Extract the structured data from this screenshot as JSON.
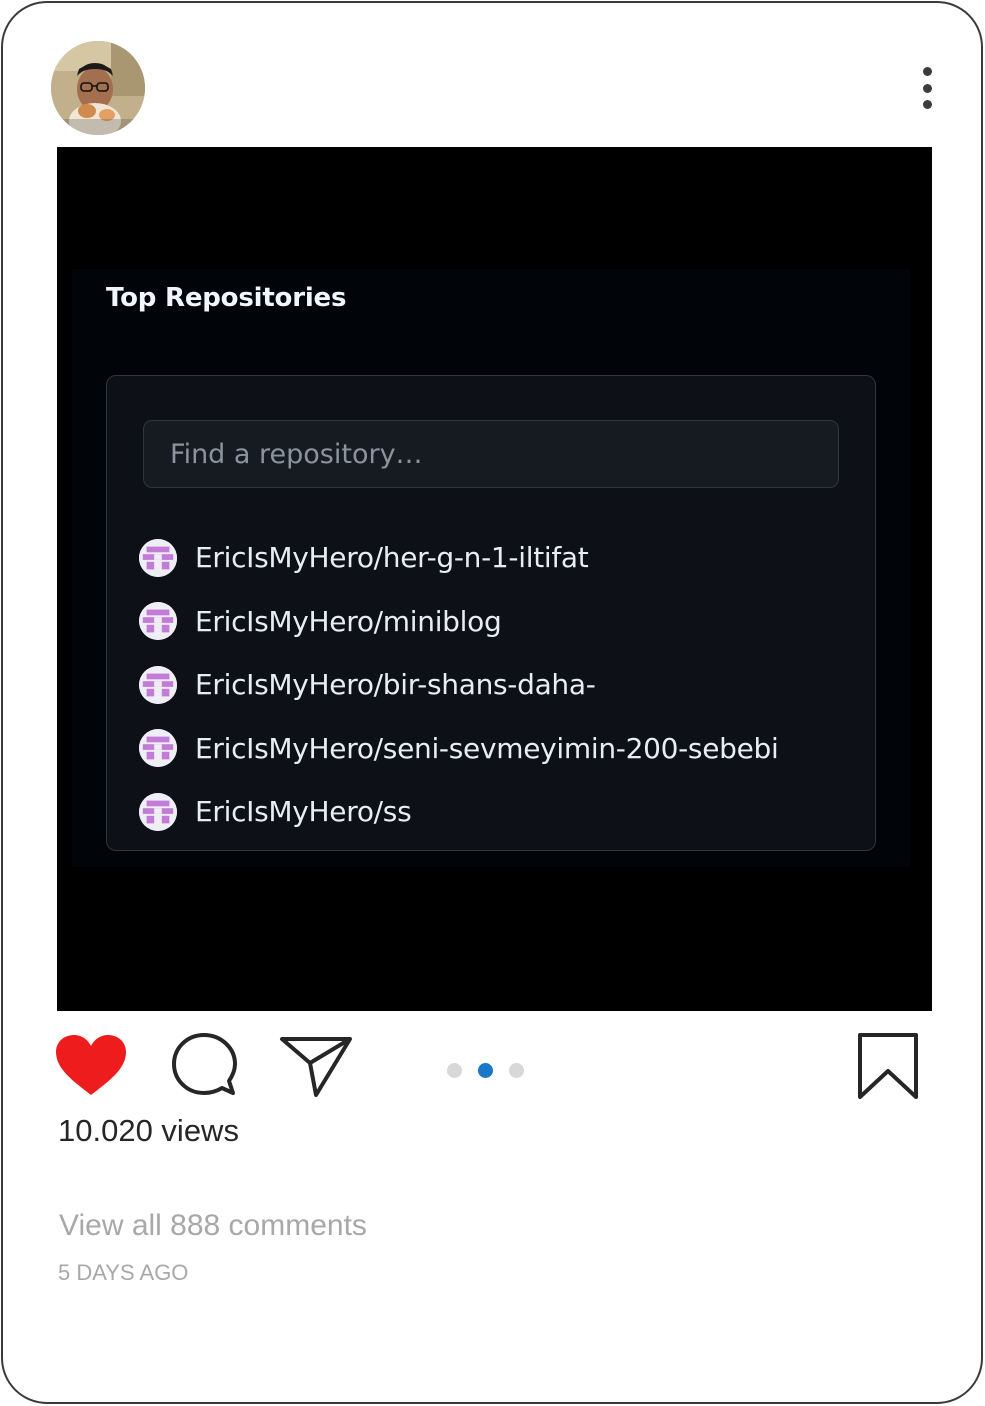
{
  "header": {
    "avatar_icon": "user-avatar",
    "more_icon": "more-vertical-icon"
  },
  "post": {
    "screenshot": {
      "title": "Top Repositories",
      "search_placeholder": "Find a repository…",
      "repos": [
        {
          "name": "EricIsMyHero/her-g-n-1-iltifat"
        },
        {
          "name": "EricIsMyHero/miniblog"
        },
        {
          "name": "EricIsMyHero/bir-shans-daha-"
        },
        {
          "name": "EricIsMyHero/seni-sevmeyimin-200-sebebi"
        },
        {
          "name": "EricIsMyHero/ss"
        }
      ]
    },
    "carousel": {
      "count": 3,
      "active_index": 1
    }
  },
  "actions": {
    "like_icon": "heart-filled-icon",
    "comment_icon": "speech-bubble-icon",
    "share_icon": "paper-plane-icon",
    "save_icon": "bookmark-icon",
    "liked": true
  },
  "stats": {
    "views": "10.020 views",
    "comments_link": "View all 888 comments",
    "time_ago": "5 DAYS AGO"
  },
  "colors": {
    "like": "#ee1c1c",
    "carousel_active": "#1a78c9",
    "github_bg": "#0d1117"
  }
}
